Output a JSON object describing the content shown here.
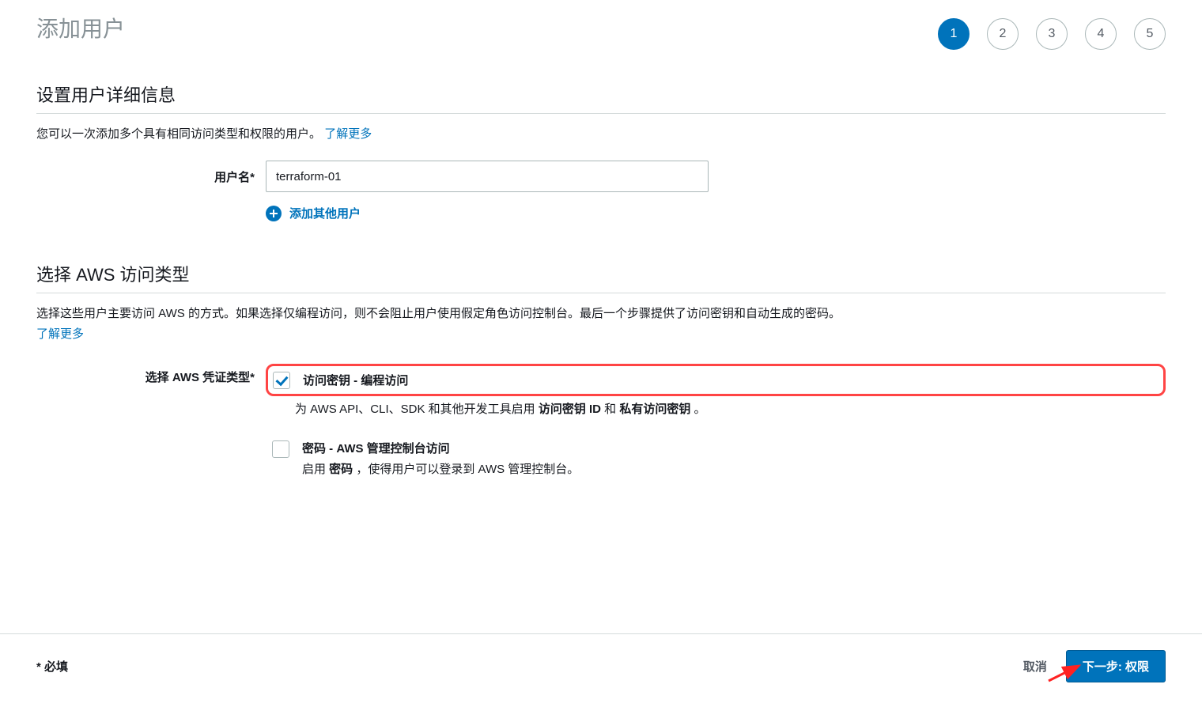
{
  "page": {
    "title": "添加用户",
    "steps": [
      "1",
      "2",
      "3",
      "4",
      "5"
    ],
    "activeStep": 1
  },
  "details": {
    "title": "设置用户详细信息",
    "desc": "您可以一次添加多个具有相同访问类型和权限的用户。",
    "learnMore": "了解更多",
    "usernameLabel": "用户名*",
    "usernameValue": "terraform-01",
    "addAnother": "添加其他用户"
  },
  "access": {
    "title": "选择 AWS 访问类型",
    "desc": "选择这些用户主要访问 AWS 的方式。如果选择仅编程访问，则不会阻止用户使用假定角色访问控制台。最后一个步骤提供了访问密钥和自动生成的密码。",
    "learnMore": "了解更多",
    "credLabel": "选择 AWS 凭证类型*",
    "option1": {
      "title": "访问密钥 - 编程访问",
      "descPrefix": "为 AWS API、CLI、SDK 和其他开发工具启用 ",
      "bold1": "访问密钥 ID",
      "mid": " 和 ",
      "bold2": "私有访问密钥",
      "suffix": " 。"
    },
    "option2": {
      "title": "密码 - AWS 管理控制台访问",
      "descPrefix": "启用 ",
      "bold1": "密码",
      "suffix": " ，使得用户可以登录到 AWS 管理控制台。"
    }
  },
  "footer": {
    "required": "* 必填",
    "cancel": "取消",
    "next": "下一步: 权限"
  }
}
